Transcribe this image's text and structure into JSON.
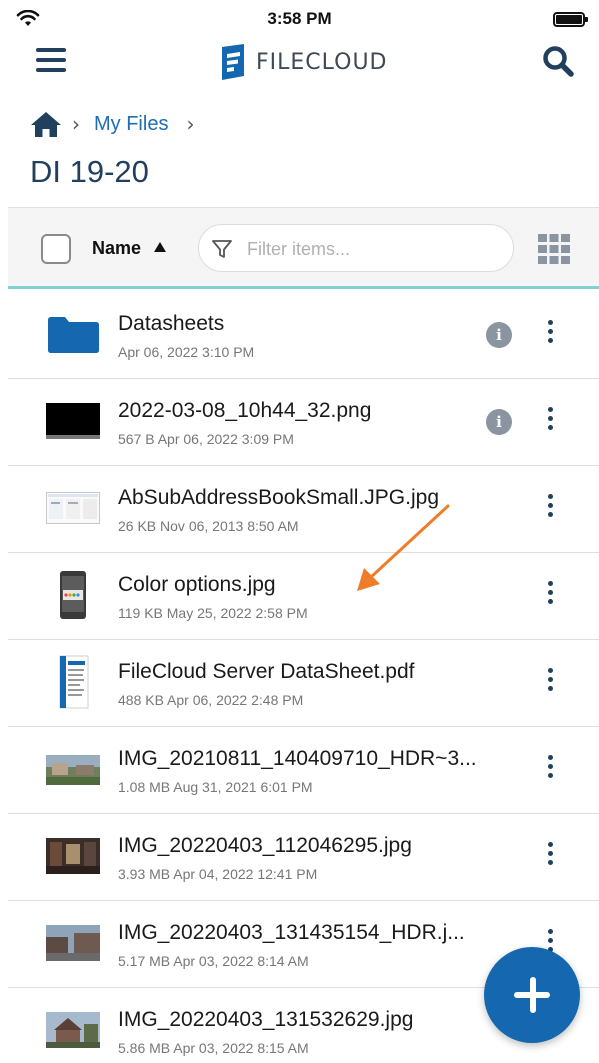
{
  "status_bar": {
    "time": "3:58 PM"
  },
  "header": {
    "logo_text": "FILECLOUD"
  },
  "breadcrumb": {
    "items": [
      "My Files"
    ]
  },
  "page_title": "DI 19-20",
  "toolbar": {
    "sort_label": "Name",
    "filter_placeholder": "Filter items..."
  },
  "files": [
    {
      "name": "Datasheets",
      "meta": "Apr 06, 2022 3:10 PM",
      "type": "folder",
      "has_info": true
    },
    {
      "name": "2022-03-08_10h44_32.png",
      "meta": "567 B Apr 06, 2022 3:09 PM",
      "type": "image-dark",
      "has_info": true
    },
    {
      "name": "AbSubAddressBookSmall.JPG.jpg",
      "meta": "26 KB Nov 06, 2013 8:50 AM",
      "type": "image-screenshot",
      "has_info": false
    },
    {
      "name": "Color options.jpg",
      "meta": "119 KB May 25, 2022 2:58 PM",
      "type": "image-phone",
      "has_info": false
    },
    {
      "name": "FileCloud Server DataSheet.pdf",
      "meta": "488 KB Apr 06, 2022 2:48 PM",
      "type": "pdf",
      "has_info": false
    },
    {
      "name": "IMG_20210811_140409710_HDR~3...",
      "meta": "1.08 MB Aug 31, 2021 6:01 PM",
      "type": "photo-landscape",
      "has_info": false
    },
    {
      "name": "IMG_20220403_112046295.jpg",
      "meta": "3.93 MB Apr 04, 2022 12:41 PM",
      "type": "photo-interior",
      "has_info": false
    },
    {
      "name": "IMG_20220403_131435154_HDR.j...",
      "meta": "5.17 MB Apr 03, 2022 8:14 AM",
      "type": "photo-street",
      "has_info": false
    },
    {
      "name": "IMG_20220403_131532629.jpg",
      "meta": "5.86 MB Apr 03, 2022 8:15 AM",
      "type": "photo-house",
      "has_info": false
    }
  ],
  "colors": {
    "brand_blue": "#1567b0",
    "navy": "#21405e",
    "accent_teal": "#7fd3d2",
    "annotation_orange": "#f07c2a"
  }
}
